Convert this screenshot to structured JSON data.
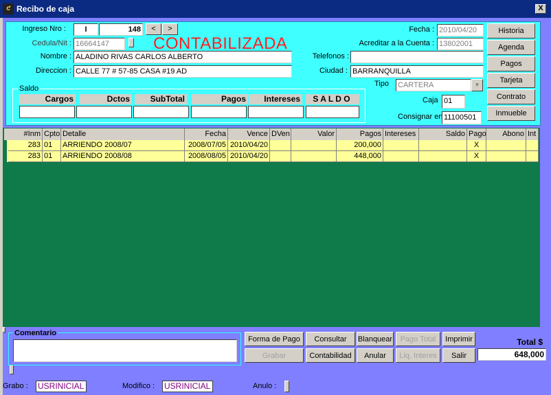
{
  "window": {
    "title": "Recibo de caja",
    "close_label": "X",
    "icon_text": "ƈ"
  },
  "form": {
    "ingreso_label": "Ingreso Nro :",
    "ingreso_tipo": "I",
    "ingreso_numero": "148",
    "prev_label": "<",
    "next_label": ">",
    "status_text": "CONTABILIZADA",
    "cedula_label": "Cedula/Nit :",
    "cedula_value": "16664147",
    "nombre_label": "Nombre :",
    "nombre_value": "ALADINO RIVAS CARLOS ALBERTO",
    "direccion_label": "Direccion :",
    "direccion_value": "CALLE 77 # 57-85 CASA #19 AD",
    "fecha_label": "Fecha :",
    "fecha_value": "2010/04/20",
    "acreditar_label": "Acreditar a la Cuenta :",
    "acreditar_value": "13802001",
    "telefonos_label": "Telefonos :",
    "telefonos_value": "",
    "ciudad_label": "Ciudad :",
    "ciudad_value": "BARRANQUILLA",
    "tipo_label": "Tipo",
    "tipo_value": "CARTERA",
    "caja_label": "Caja",
    "caja_value": "01",
    "consignar_label": "Consignar en",
    "consignar_value": "11100501"
  },
  "saldo": {
    "group_label": "Saldo",
    "headers": [
      "Cargos",
      "Dctos",
      "SubTotal",
      "Pagos",
      "Intereses",
      "S A L D O"
    ]
  },
  "side_buttons": [
    "Historia",
    "Agenda",
    "Pagos",
    "Tarjeta",
    "Contrato",
    "Inmueble"
  ],
  "grid": {
    "columns": [
      "#Inm",
      "Cpto",
      "Detalle",
      "Fecha",
      "Vence",
      "DVen",
      "Valor",
      "Pagos",
      "Intereses",
      "Saldo",
      "Pago",
      "Abono",
      "Int"
    ],
    "rows": [
      [
        "283",
        "01",
        "ARRIENDO 2008/07",
        "2008/07/05",
        "2010/04/20",
        "",
        "",
        "200,000",
        "",
        "",
        "X",
        "",
        ""
      ],
      [
        "283",
        "01",
        "ARRIENDO 2008/08",
        "2008/08/05",
        "2010/04/20",
        "",
        "",
        "448,000",
        "",
        "",
        "X",
        "",
        ""
      ]
    ]
  },
  "comentario": {
    "label": "Comentario",
    "value": ""
  },
  "actions": {
    "forma_pago": "Forma de Pago",
    "consultar": "Consultar",
    "blanquear": "Blanquear",
    "pago_total": "Pago Total",
    "imprimir": "Imprimir",
    "grabar": "Grabar",
    "contabilidad": "Contabilidad",
    "anular": "Anular",
    "liq_intereses": "Liq. Interes",
    "salir": "Salir"
  },
  "total": {
    "label": "Total  $",
    "value": "648,000"
  },
  "footer": {
    "grabo_label": "Grabo :",
    "grabo_value": "USRINICIAL",
    "modifico_label": "Modifico :",
    "modifico_value": "USRINICIAL",
    "anulo_label": "Anulo :"
  },
  "colors": {
    "header_bg": "#3fffff",
    "window_bg": "#7f7fff",
    "grid_bg": "#0f7a4a",
    "row_bg": "#ffff99",
    "status_red": "#ff2020"
  }
}
